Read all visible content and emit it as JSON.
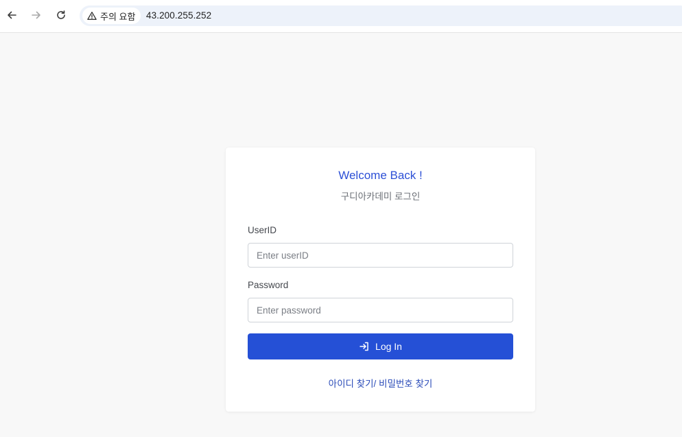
{
  "browser": {
    "security_label": "주의 요함",
    "url": "43.200.255.252"
  },
  "login": {
    "title": "Welcome Back !",
    "subtitle": "구디아카데미 로그인",
    "userid_label": "UserID",
    "userid_placeholder": "Enter userID",
    "password_label": "Password",
    "password_placeholder": "Enter password",
    "login_button_label": "Log In",
    "find_id_link": "아이디 찾기",
    "separator": "/ ",
    "find_password_link": "비밀번호 찾기"
  },
  "colors": {
    "primary": "#2550d6",
    "title": "#2c4fd6",
    "background": "#f8f8f8"
  }
}
